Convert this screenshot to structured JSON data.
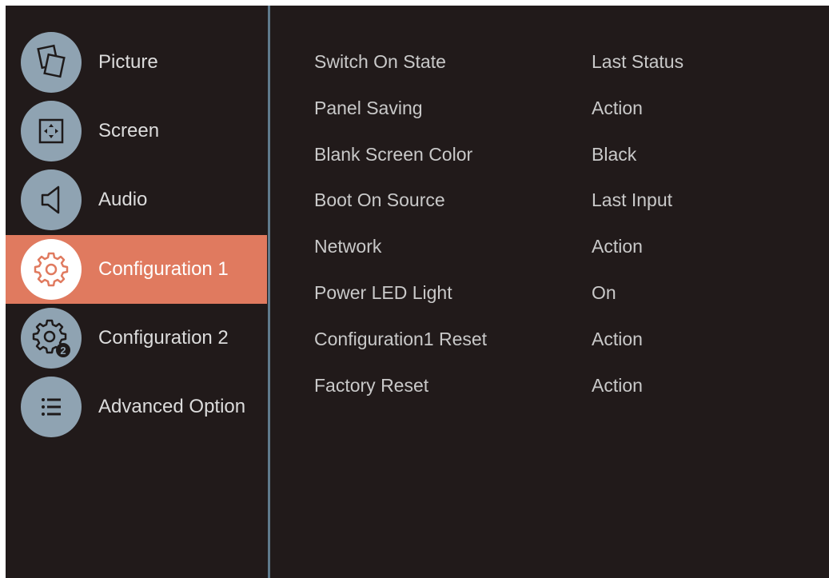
{
  "menu": {
    "items": [
      {
        "label": "Picture",
        "icon": "picture-icon",
        "selected": false
      },
      {
        "label": "Screen",
        "icon": "screen-icon",
        "selected": false
      },
      {
        "label": "Audio",
        "icon": "speaker-icon",
        "selected": false
      },
      {
        "label": "Configuration 1",
        "icon": "gear-icon",
        "selected": true
      },
      {
        "label": "Configuration 2",
        "icon": "gear-2-icon",
        "selected": false
      },
      {
        "label": "Advanced Option",
        "icon": "list-icon",
        "selected": false
      }
    ]
  },
  "settings": [
    {
      "name": "Switch On State",
      "value": "Last Status"
    },
    {
      "name": "Panel Saving",
      "value": "Action"
    },
    {
      "name": "Blank Screen Color",
      "value": "Black"
    },
    {
      "name": "Boot On Source",
      "value": "Last Input"
    },
    {
      "name": "Network",
      "value": "Action"
    },
    {
      "name": "Power LED Light",
      "value": "On"
    },
    {
      "name": "Configuration1 Reset",
      "value": "Action"
    },
    {
      "name": "Factory Reset",
      "value": "Action"
    }
  ],
  "colors": {
    "background": "#211a1a",
    "selected": "#e07a5f",
    "icon_circle": "#8fa3b2",
    "divider": "#5f7a8c",
    "text": "#c9c9c9"
  }
}
